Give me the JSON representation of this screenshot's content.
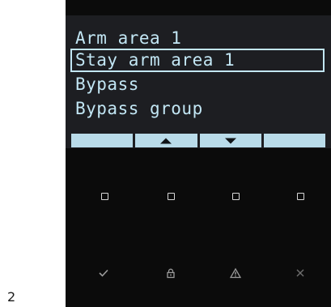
{
  "page_number": "2",
  "menu": {
    "items": [
      {
        "label": "Arm area 1",
        "selected": false
      },
      {
        "label": "Stay arm area 1",
        "selected": true
      },
      {
        "label": "Bypass",
        "selected": false
      },
      {
        "label": "Bypass group",
        "selected": false
      }
    ]
  },
  "softkeys": [
    {
      "icon": "blank"
    },
    {
      "icon": "up-arrow-icon"
    },
    {
      "icon": "down-arrow-icon"
    },
    {
      "icon": "blank"
    }
  ],
  "function_keys": [
    "square-key-icon",
    "square-key-icon",
    "square-key-icon",
    "square-key-icon"
  ],
  "action_keys": [
    "check-icon",
    "lock-icon",
    "warning-icon",
    "cancel-x-icon"
  ],
  "colors": {
    "lcd_text": "#c2e6f4",
    "lcd_background": "#1d1e22",
    "softkey_bar": "#b9dbe9",
    "device_body": "#0b0b0b"
  }
}
